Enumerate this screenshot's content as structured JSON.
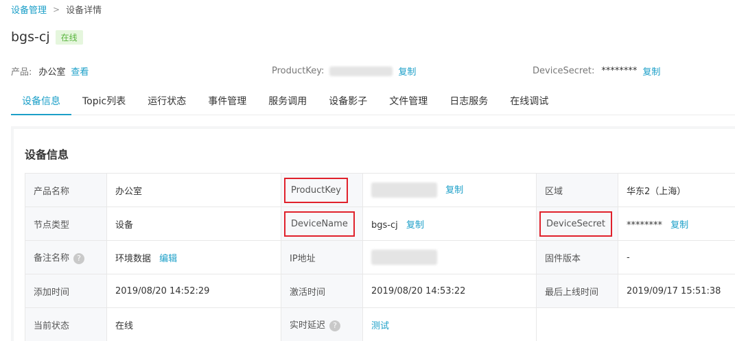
{
  "breadcrumb": {
    "parent": "设备管理",
    "separator": ">",
    "current": "设备详情"
  },
  "device": {
    "name": "bgs-cj",
    "status_badge": "在线"
  },
  "meta": {
    "product_label": "产品:",
    "product_value": "办公室",
    "product_view": "查看",
    "productkey_label": "ProductKey:",
    "productkey_copy": "复制",
    "devicesecret_label": "DeviceSecret:",
    "devicesecret_value": "********",
    "devicesecret_copy": "复制"
  },
  "tabs": [
    "设备信息",
    "Topic列表",
    "运行状态",
    "事件管理",
    "服务调用",
    "设备影子",
    "文件管理",
    "日志服务",
    "在线调试"
  ],
  "active_tab": 0,
  "section_title": "设备信息",
  "table": {
    "r1": {
      "k1": "产品名称",
      "v1": "办公室",
      "k2": "ProductKey",
      "v2_action": "复制",
      "k3": "区域",
      "v3": "华东2（上海）"
    },
    "r2": {
      "k1": "节点类型",
      "v1": "设备",
      "k2": "DeviceName",
      "v2": "bgs-cj",
      "v2_action": "复制",
      "k3": "DeviceSecret",
      "v3": "********",
      "v3_action": "复制"
    },
    "r3": {
      "k1": "备注名称",
      "v1": "环境数据",
      "v1_action": "编辑",
      "k2": "IP地址",
      "k3": "固件版本",
      "v3": "-"
    },
    "r4": {
      "k1": "添加时间",
      "v1": "2019/08/20 14:52:29",
      "k2": "激活时间",
      "v2": "2019/08/20 14:53:22",
      "k3": "最后上线时间",
      "v3": "2019/09/17 15:51:38"
    },
    "r5": {
      "k1": "当前状态",
      "v1": "在线",
      "k2": "实时延迟",
      "v2_action": "测试"
    }
  },
  "icons": {
    "help": "question-circle-icon"
  },
  "colors": {
    "accent": "#1b9fc8",
    "online": "#58b43c",
    "highlight": "#e0202a"
  }
}
